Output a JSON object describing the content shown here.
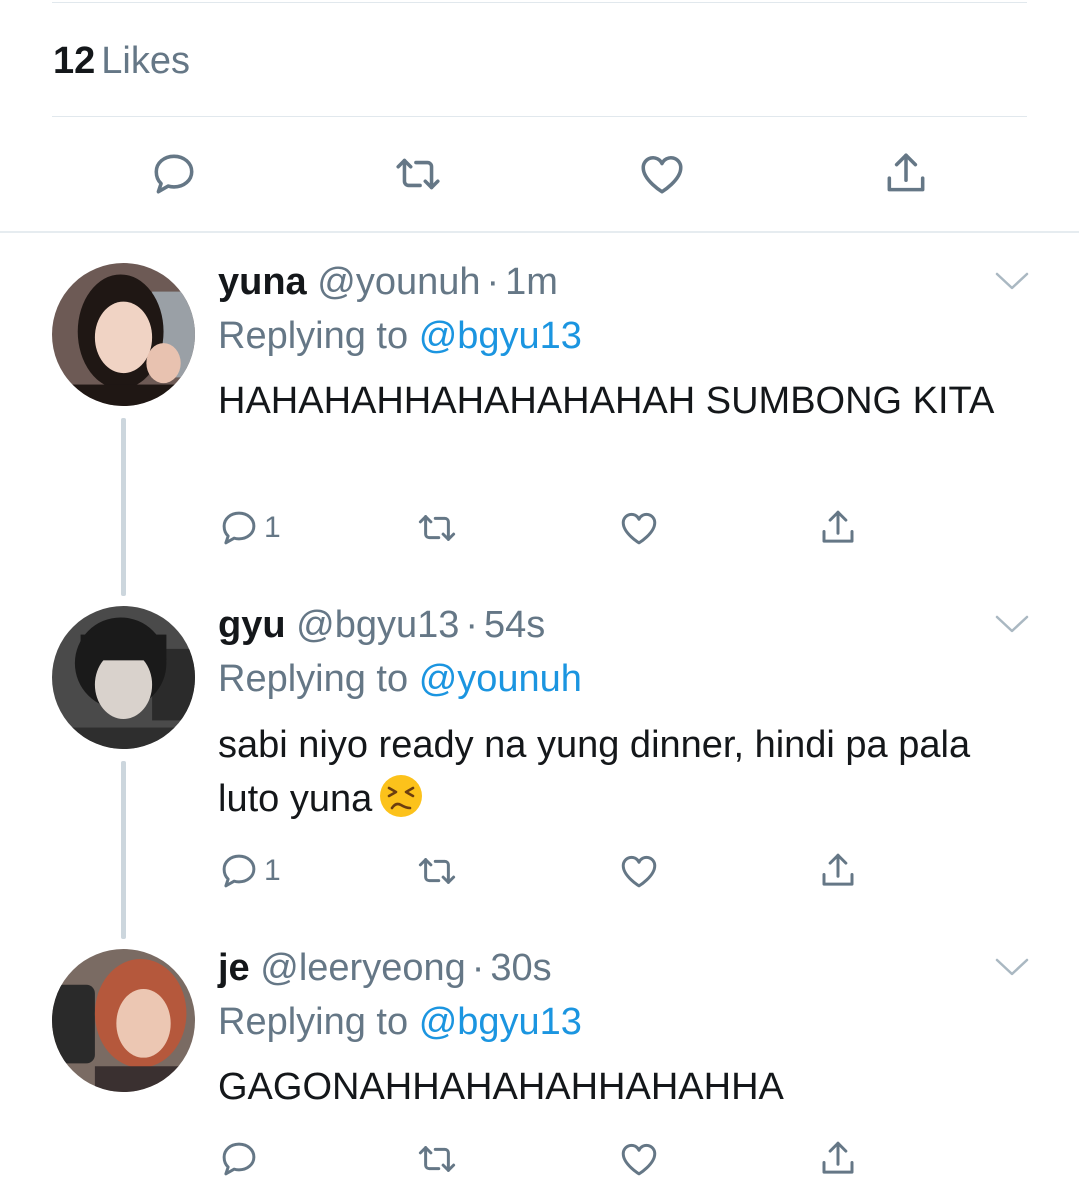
{
  "likes": {
    "count": "12",
    "label": "Likes"
  },
  "main_actions": [
    {
      "icon": "reply-icon"
    },
    {
      "icon": "retweet-icon"
    },
    {
      "icon": "like-icon"
    },
    {
      "icon": "share-icon"
    }
  ],
  "replies": [
    {
      "name": "yuna",
      "handle": "@younuh",
      "dot": "·",
      "time": "1m",
      "replying_prefix": "Replying to",
      "replying_to": "@bgyu13",
      "text": "HAHAHAHHAHAHAHAHAH SUMBONG KITA",
      "reply_count": "1",
      "avatar_palette": [
        "#6d5a55",
        "#f0d3c4",
        "#1f1714"
      ]
    },
    {
      "name": "gyu",
      "handle": "@bgyu13",
      "dot": "·",
      "time": "54s",
      "replying_prefix": "Replying to",
      "replying_to": "@younuh",
      "text": "sabi niyo ready na yung dinner, hindi pa pala luto yuna",
      "emoji": "persevering-face",
      "reply_count": "1",
      "avatar_palette": [
        "#4a4a4a",
        "#d9d2cc",
        "#1a1a1a"
      ]
    },
    {
      "name": "je",
      "handle": "@leeryeong",
      "dot": "·",
      "time": "30s",
      "replying_prefix": "Replying to",
      "replying_to": "@bgyu13",
      "text": "GAGONAHHAHAHAHHAHAHHA",
      "reply_count": "",
      "avatar_palette": [
        "#7a6b63",
        "#ecc7b3",
        "#b5583c"
      ]
    }
  ],
  "colors": {
    "text": "#14171a",
    "secondary": "#657786",
    "link": "#1b95e0",
    "divider": "#e1e8ed",
    "thread_line": "#ccd6dd"
  }
}
